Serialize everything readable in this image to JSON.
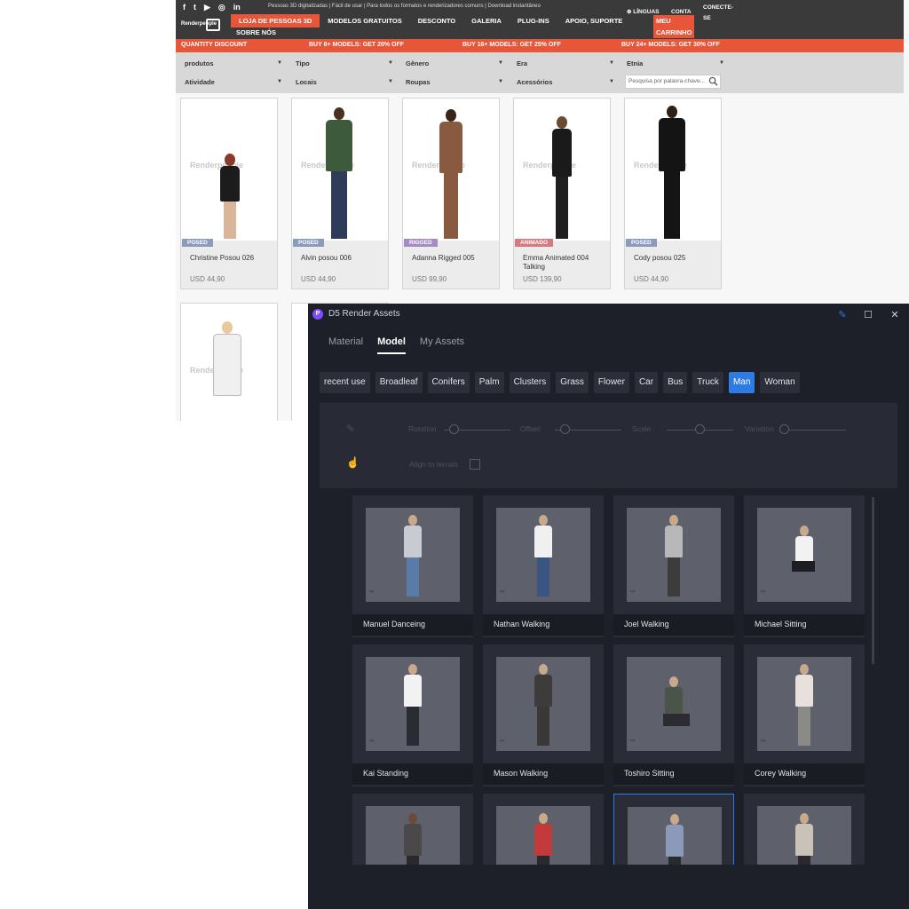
{
  "website": {
    "social_icons": [
      "facebook-icon",
      "twitter-icon",
      "youtube-icon",
      "instagram-icon",
      "linkedin-icon"
    ],
    "social_glyphs": [
      "f",
      "t",
      "▶",
      "◎",
      "in"
    ],
    "tagline": "Pessoas 3D digitalizadas | Fácil de usar | Para todos os formatos e renderizadores comuns | Download instantâneo",
    "logo_text": "Renderpeople",
    "nav": [
      "LOJA DE PESSOAS 3D",
      "MODELOS GRATUITOS",
      "DESCONTO",
      "GALERIA",
      "PLUG-INS",
      "APOIO, SUPORTE"
    ],
    "nav_second_row": "SOBRE NÓS",
    "languages": "LÍNGUAS",
    "account": "CONTA",
    "cart": [
      "MEU",
      "CARRINHO"
    ],
    "connect": [
      "CONECTE-",
      "SE"
    ],
    "promo": {
      "label": "QUANTITY DISCOUNT",
      "tier1": "BUY 8+ MODELS: GET 20% OFF",
      "tier2": "BUY 16+ MODELS: GET 25% OFF",
      "tier3": "BUY 24+ MODELS: GET 30% OFF"
    },
    "filters": [
      "produtos",
      "Tipo",
      "Gênero",
      "Era",
      "Etnia",
      "Atividade",
      "Locais",
      "Roupas",
      "Acessórios"
    ],
    "search_placeholder": "Pesquisa por palavra-chave...",
    "watermark": "Renderpeople",
    "products": [
      {
        "badge": "POSED",
        "badge_color": "#8a9bbd",
        "name": "Christine Posou 026",
        "price": "USD  44,90"
      },
      {
        "badge": "POSED",
        "badge_color": "#8a9bbd",
        "name": "Alvin posou 006",
        "price": "USD  44,90"
      },
      {
        "badge": "RIGGED",
        "badge_color": "#a58bc4",
        "name": "Adanna Rigged 005",
        "price": "USD  99,90"
      },
      {
        "badge": "ANIMADO",
        "badge_color": "#d77a80",
        "name": "Emma Animated 004 Talking",
        "price": "USD  139,90"
      },
      {
        "badge": "POSED",
        "badge_color": "#8a9bbd",
        "name": "Cody posou 025",
        "price": "USD  44,90"
      }
    ]
  },
  "d5": {
    "logo_letter": "P",
    "title": "D5 Render Assets",
    "tabs": [
      "Material",
      "Model",
      "My Assets"
    ],
    "active_tab": "Model",
    "categories": [
      "recent use",
      "Broadleaf",
      "Conifers",
      "Palm",
      "Clusters",
      "Grass",
      "Flower",
      "Car",
      "Bus",
      "Truck",
      "Man",
      "Woman"
    ],
    "active_category": "Man",
    "sliders": [
      "Rotation",
      "Offset",
      "Scale",
      "Variation"
    ],
    "align_label": "Align to terrain",
    "accent": "#2d7be5",
    "assets": [
      {
        "name": "Manuel Danceing"
      },
      {
        "name": "Nathan Walking"
      },
      {
        "name": "Joel Walking"
      },
      {
        "name": "Michael Sitting"
      },
      {
        "name": "Kai Standing"
      },
      {
        "name": "Mason Walking"
      },
      {
        "name": "Toshiro Sitting"
      },
      {
        "name": "Corey Walking"
      },
      {
        "name": ""
      },
      {
        "name": ""
      },
      {
        "name": ""
      },
      {
        "name": ""
      }
    ]
  }
}
